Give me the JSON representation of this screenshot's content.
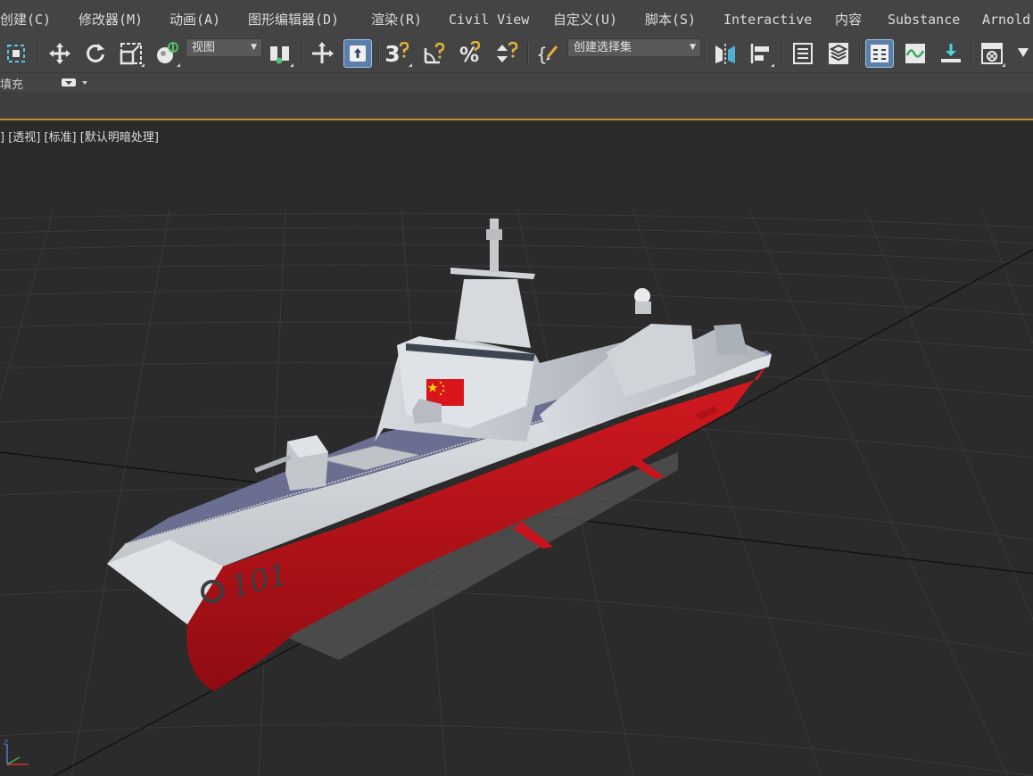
{
  "menu": {
    "items": [
      {
        "label": "创建(C)"
      },
      {
        "label": "修改器(M)"
      },
      {
        "label": "动画(A)"
      },
      {
        "label": "图形编辑器(D)"
      },
      {
        "label": "渲染(R)"
      },
      {
        "label": "Civil View"
      },
      {
        "label": "自定义(U)"
      },
      {
        "label": "脚本(S)"
      },
      {
        "label": "Interactive"
      },
      {
        "label": "内容"
      },
      {
        "label": "Substance"
      },
      {
        "label": "Arnold"
      }
    ]
  },
  "toolbar": {
    "reference_coord_dropdown": "视图",
    "selection_set_dropdown": "创建选择集",
    "snap_label": "3",
    "active_tools": [
      "select-and-manipulate",
      "layer-explorer"
    ],
    "icons": [
      "select-object-icon",
      "move-icon",
      "rotate-icon",
      "scale-icon",
      "place-icon",
      "pivot-center-icon",
      "transform-gizmo-icon",
      "manipulate-icon",
      "snap-3d-icon",
      "angle-snap-icon",
      "percent-snap-icon",
      "spinner-snap-icon",
      "named-selection-icon",
      "mirror-icon",
      "align-icon",
      "scene-explorer-icon",
      "layer-manager-icon",
      "layer-explorer-icon",
      "curve-editor-icon",
      "schematic-view-icon",
      "material-editor-icon"
    ]
  },
  "ribbon": {
    "label": "填充"
  },
  "viewport": {
    "label": "] [透视] [标准] [默认明暗处理]",
    "hull_number": "101",
    "axis_label": "z"
  },
  "colors": {
    "ui_background": "#444444",
    "viewport_background": "#2b2b2b",
    "active_button": "#5b7fa8",
    "active_border": "#c6902c",
    "hull_gray": "#c8cdd2",
    "hull_red": "#c1121a",
    "deck": "#6a6f92"
  }
}
